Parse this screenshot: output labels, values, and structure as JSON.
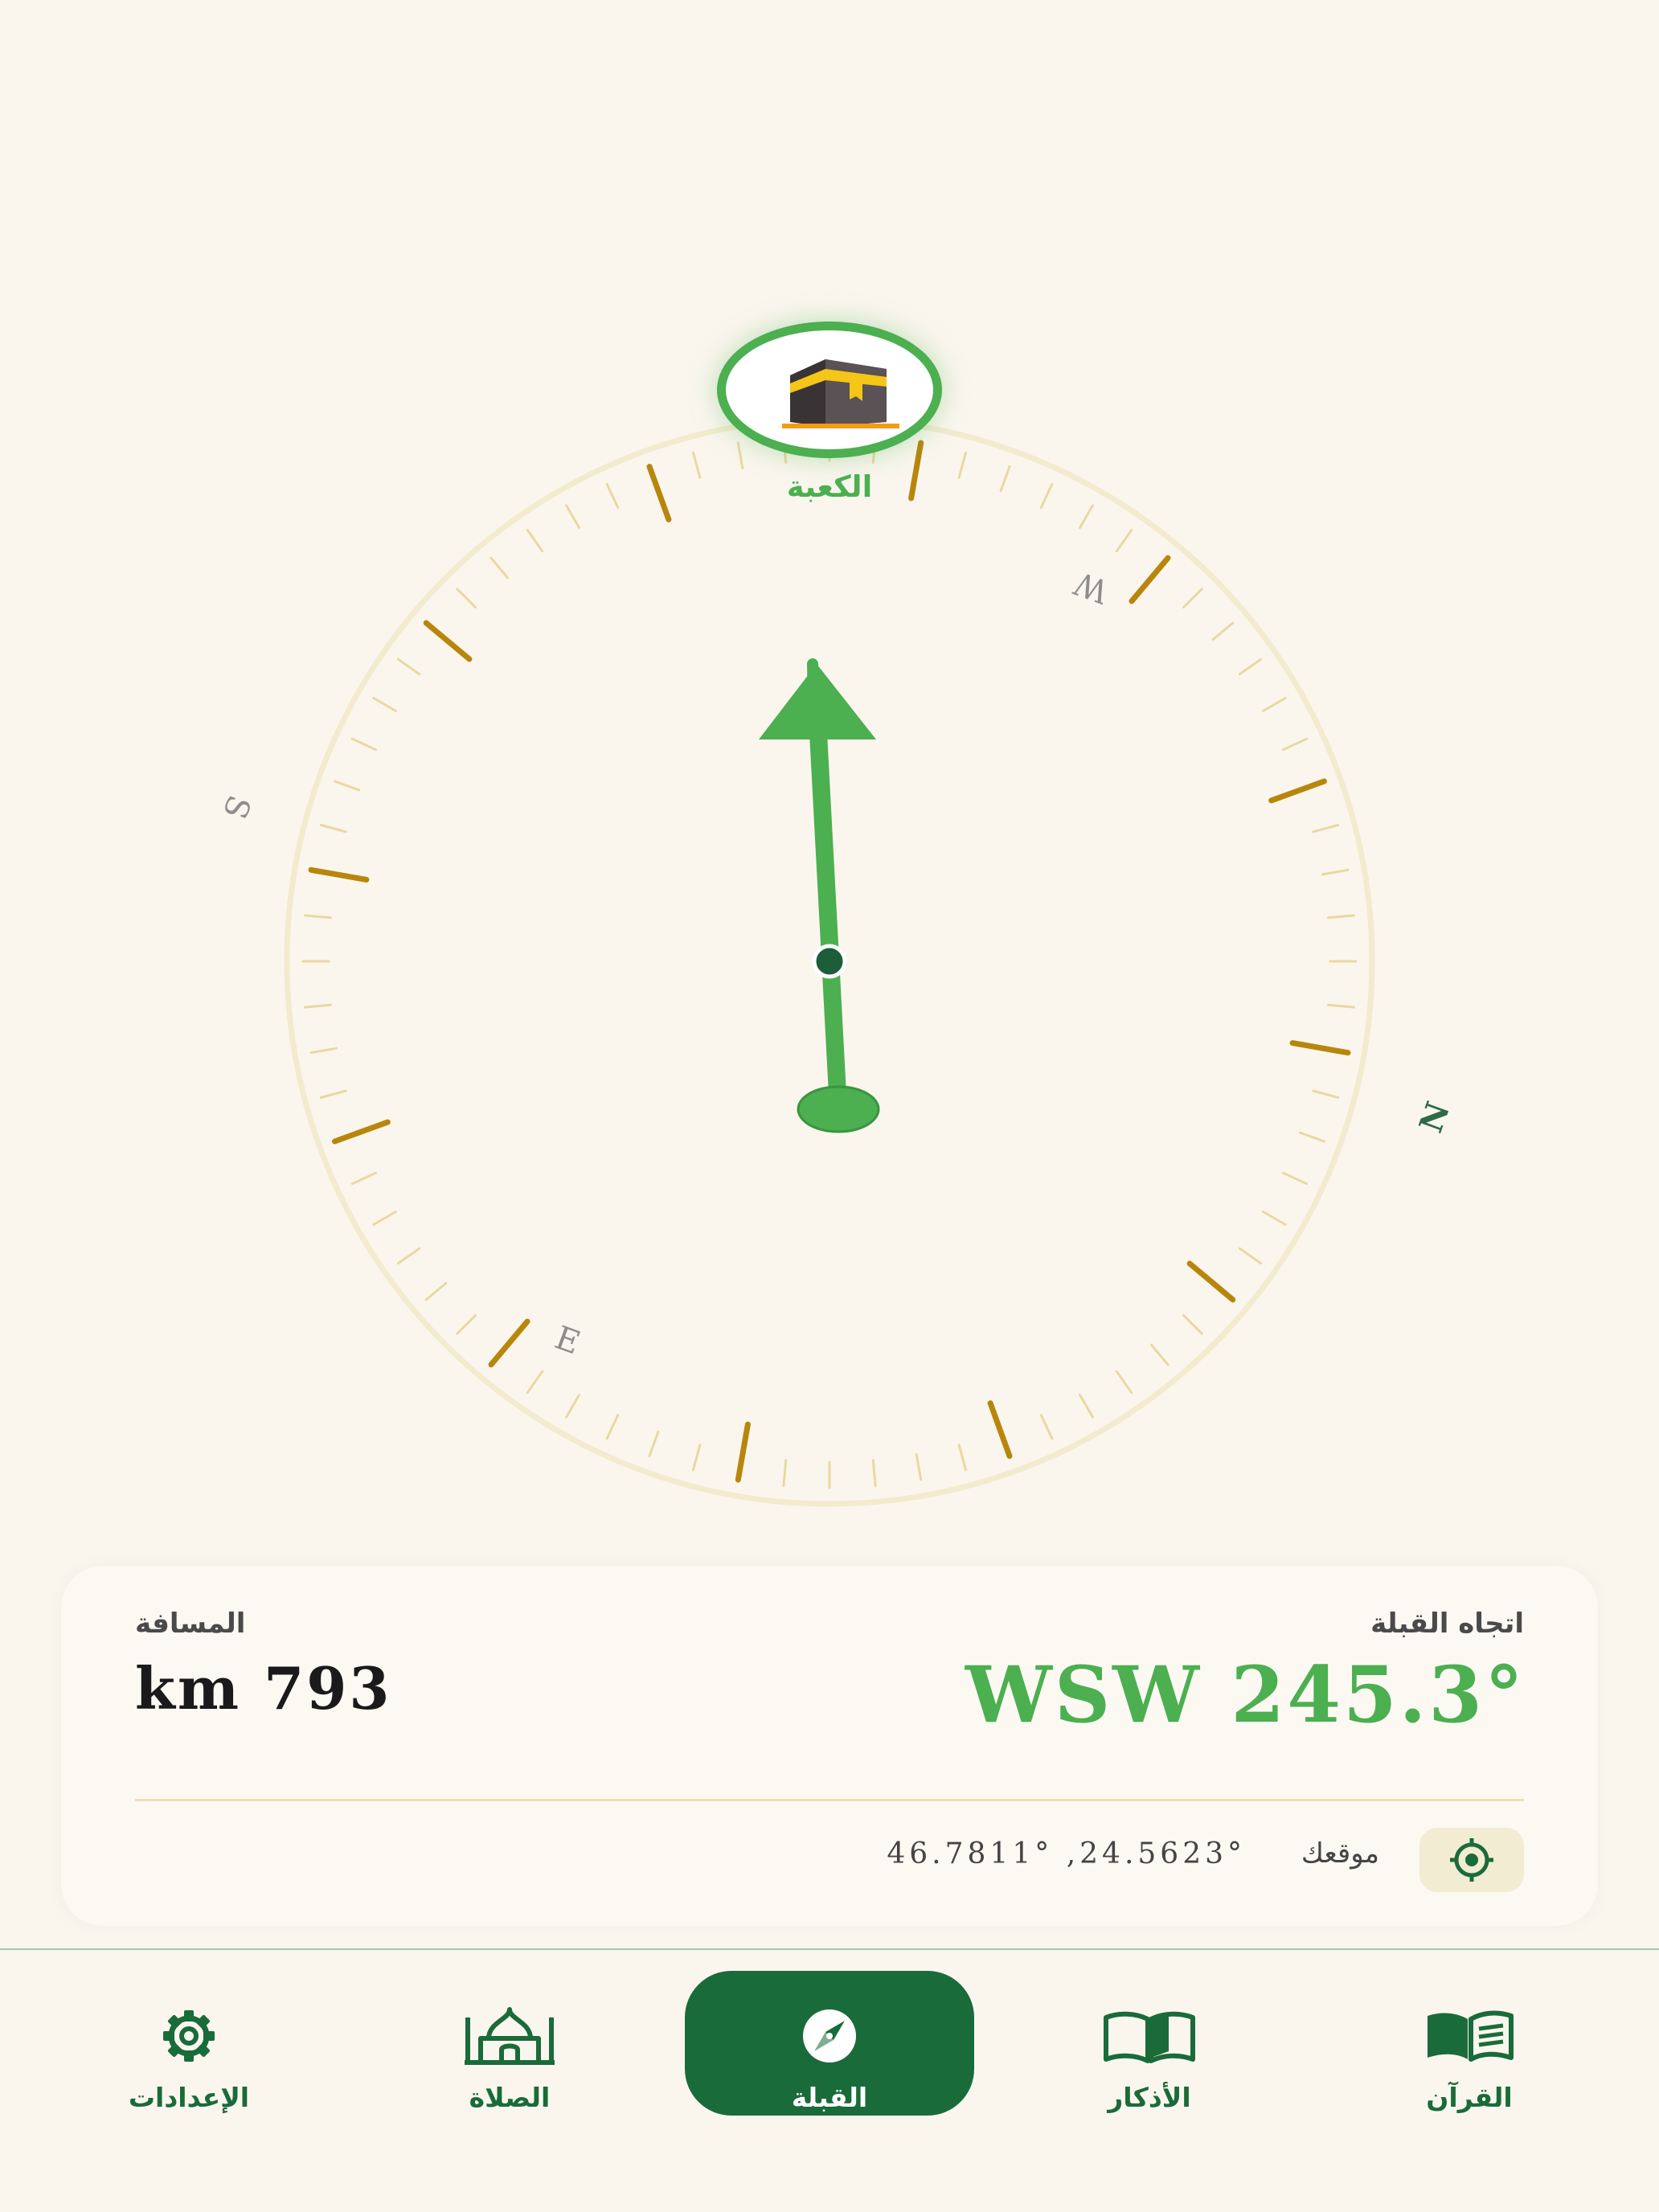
{
  "kaaba": {
    "label": "الكعبة",
    "icon": "kaaba-icon"
  },
  "compass": {
    "cardinals": {
      "north": "N",
      "south": "S",
      "east": "E",
      "west": "W"
    },
    "needle_color": "#4caf50",
    "major_tick_color": "#b8860b",
    "minor_tick_color": "#e8d9a0",
    "ring_color": "#f2ebce"
  },
  "card": {
    "qibla_label": "اتجاه القبلة",
    "qibla_value": "WSW 245.3°",
    "distance_label": "المسافة",
    "distance_value": "km 793",
    "location_label": "موقعك",
    "location_coords": "46.7811° ,24.5623°",
    "location_icon": "crosshair-icon"
  },
  "nav": {
    "settings": {
      "label": "الإعدادات",
      "icon": "gear-icon"
    },
    "prayer": {
      "label": "الصلاة",
      "icon": "mosque-icon"
    },
    "qibla": {
      "label": "القبلة",
      "icon": "compass-icon",
      "active": true
    },
    "adhkar": {
      "label": "الأذكار",
      "icon": "open-book-icon"
    },
    "quran": {
      "label": "القرآن",
      "icon": "quran-book-icon"
    }
  },
  "colors": {
    "background": "#faf6ee",
    "primary_green": "#4caf50",
    "dark_green": "#1a6b3a",
    "gold": "#b8860b"
  }
}
